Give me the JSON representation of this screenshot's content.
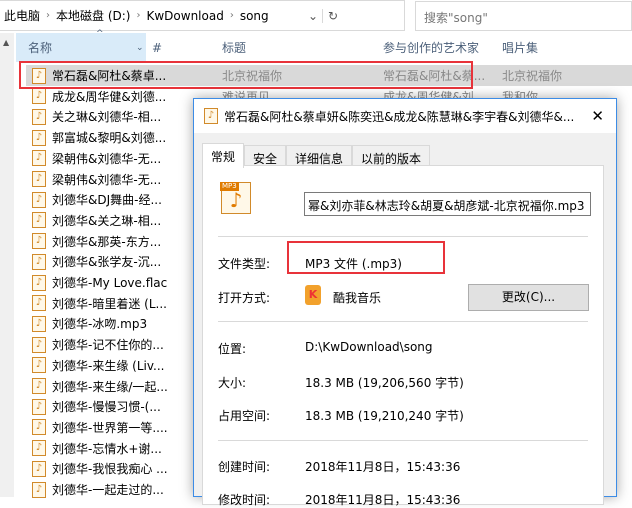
{
  "address": {
    "crumbs": [
      "此电脑",
      "本地磁盘 (D:)",
      "KwDownload",
      "song"
    ],
    "search_placeholder": "搜索\"song\""
  },
  "columns": {
    "name": "名称",
    "num": "#",
    "title": "标题",
    "artist": "参与创作的艺术家",
    "album": "唱片集"
  },
  "files": [
    {
      "name": "常石磊&阿杜&蔡卓...",
      "title": "北京祝福你",
      "artist": "常石磊&阿杜&蔡...",
      "album": "北京祝福你"
    },
    {
      "name": "成龙&周华健&刘德...",
      "title": "难说再见",
      "artist": "成龙&周华健&刘...",
      "album": "我和你"
    },
    {
      "name": "关之琳&刘德华-相..."
    },
    {
      "name": "郭富城&黎明&刘德..."
    },
    {
      "name": "梁朝伟&刘德华-无..."
    },
    {
      "name": "梁朝伟&刘德华-无..."
    },
    {
      "name": "刘德华&DJ舞曲-经..."
    },
    {
      "name": "刘德华&关之琳-相..."
    },
    {
      "name": "刘德华&那英-东方..."
    },
    {
      "name": "刘德华&张学友-沉..."
    },
    {
      "name": "刘德华-My Love.flac"
    },
    {
      "name": "刘德华-暗里着迷 (L..."
    },
    {
      "name": "刘德华-冰吻.mp3"
    },
    {
      "name": "刘德华-记不住你的..."
    },
    {
      "name": "刘德华-来生缘 (Liv..."
    },
    {
      "name": "刘德华-来生缘/一起..."
    },
    {
      "name": "刘德华-慢慢习惯-(..."
    },
    {
      "name": "刘德华-世界第一等...."
    },
    {
      "name": "刘德华-忘情水+谢..."
    },
    {
      "name": "刘德华-我恨我痴心 ..."
    },
    {
      "name": "刘德华-一起走过的..."
    }
  ],
  "dialog": {
    "title": "常石磊&阿杜&蔡卓妍&陈奕迅&成龙&陈慧琳&李宇春&刘德华&...",
    "close": "✕",
    "tabs": [
      "常规",
      "安全",
      "详细信息",
      "以前的版本"
    ],
    "filename": "幂&刘亦菲&林志玲&胡夏&胡彦斌-北京祝福你.mp3",
    "type_label": "文件类型:",
    "type_value": "MP3 文件 (.mp3)",
    "open_label": "打开方式:",
    "open_value": "酷我音乐",
    "change_button": "更改(C)...",
    "location_label": "位置:",
    "location_value": "D:\\KwDownload\\song",
    "size_label": "大小:",
    "size_value": "18.3 MB (19,206,560 字节)",
    "disk_label": "占用空间:",
    "disk_value": "18.3 MB (19,210,240 字节)",
    "created_label": "创建时间:",
    "created_value": "2018年11月8日，15:43:36",
    "modified_label": "修改时间:",
    "modified_value": "2018年11月8日，15:43:36"
  }
}
